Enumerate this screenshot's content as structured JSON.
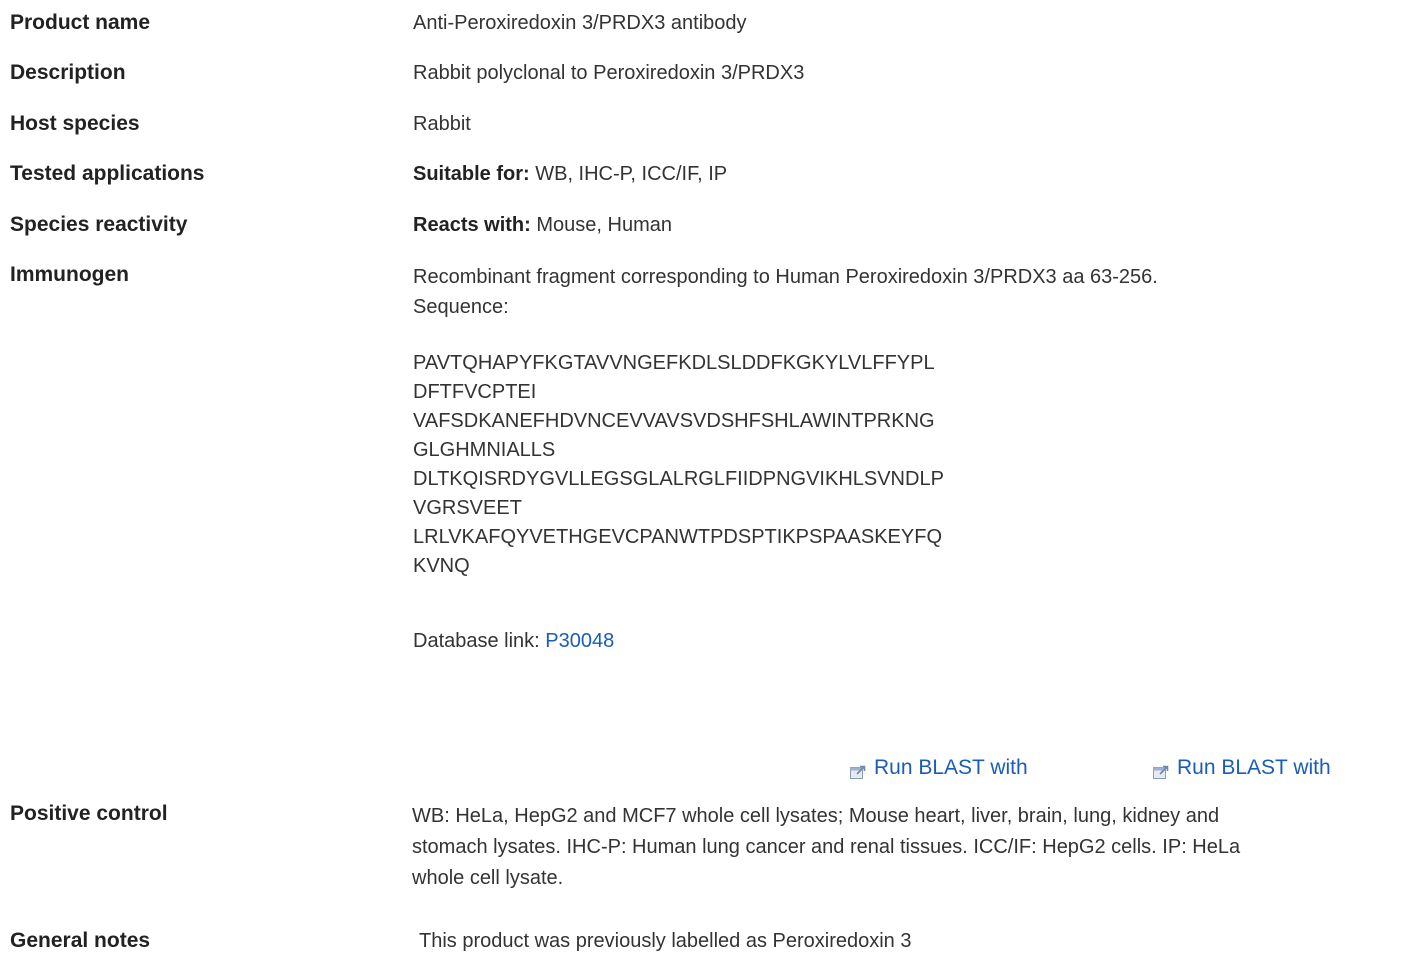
{
  "rows": {
    "product_name": {
      "label": "Product name",
      "value": "Anti-Peroxiredoxin 3/PRDX3 antibody"
    },
    "description": {
      "label": "Description",
      "value": "Rabbit polyclonal to Peroxiredoxin 3/PRDX3"
    },
    "host_species": {
      "label": "Host species",
      "value": "Rabbit"
    },
    "tested_applications": {
      "label": "Tested applications",
      "prefix": "Suitable for:",
      "value": " WB, IHC-P, ICC/IF, IP"
    },
    "species_reactivity": {
      "label": "Species reactivity",
      "prefix": "Reacts with:",
      "value": " Mouse, Human"
    },
    "immunogen": {
      "label": "Immunogen",
      "line1": "Recombinant fragment corresponding to Human Peroxiredoxin 3/PRDX3 aa 63-256.",
      "line2": "Sequence:",
      "sequence": [
        "PAVTQHAPYFKGTAVVNGEFKDLSLDDFKGKYLVLFFYPL",
        "DFTFVCPTEI",
        "VAFSDKANEFHDVNCEVVAVSVDSHFSHLAWINTPRKNG",
        "GLGHMNIALLS",
        "DLTKQISRDYGVLLEGSGLALRGLFIIDPNGVIKHLSVNDLP",
        "VGRSVEET",
        "LRLVKAFQYVETHGEVCPANWTPDSPTIKPSPAASKEYFQ",
        "KVNQ"
      ],
      "db_label": "Database link: ",
      "db_link": "P30048",
      "blast_1": "Run BLAST with",
      "blast_2": "Run BLAST with"
    },
    "positive_control": {
      "label": "Positive control",
      "line1": "WB: HeLa, HepG2 and MCF7 whole cell lysates; Mouse heart, liver, brain, lung, kidney and",
      "line2": "stomach lysates. IHC-P: Human lung cancer and renal tissues. ICC/IF: HepG2 cells. IP: HeLa",
      "line3": "whole cell lysate."
    },
    "general_notes": {
      "label": "General notes",
      "value": "This product was previously labelled as Peroxiredoxin 3"
    }
  },
  "colors": {
    "link": "#1a5db8",
    "label": "#222222",
    "text": "#333333"
  },
  "icons": {
    "blast": "external-link-icon"
  }
}
